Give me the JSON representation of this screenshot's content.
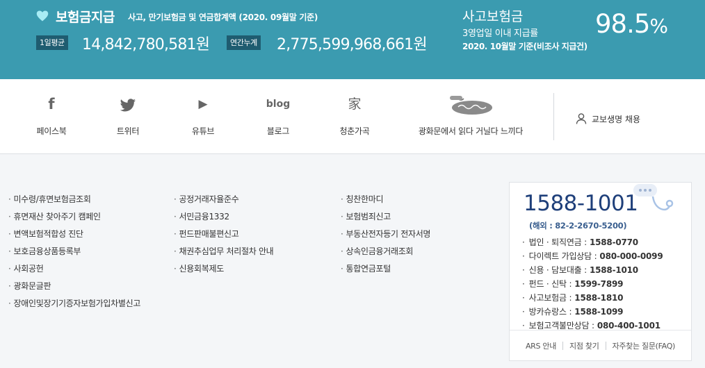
{
  "banner": {
    "title": "보험금지급",
    "subtitle": "사고, 만기보험금 및 연금합계액 (2020. 09월말 기준)",
    "daily_tag": "1일평균",
    "daily_amount": "14,842,780,581원",
    "annual_tag": "연간누계",
    "annual_amount": "2,775,599,968,661원",
    "accident_title": "사고보험금",
    "accident_line1": "3영업일 이내 지급률",
    "accident_line2": "2020. 10월말 기준(비조사 지급건)",
    "accident_rate": "98.5",
    "accident_rate_unit": "%",
    "heart_color": "#a8ecf5",
    "bg_color": "#3b9bb0"
  },
  "social": {
    "items": [
      {
        "icon": "facebook-icon",
        "glyph": "f",
        "label": "페이스북"
      },
      {
        "icon": "twitter-icon",
        "glyph": "",
        "label": "트위터"
      },
      {
        "icon": "youtube-icon",
        "glyph": "▶",
        "label": "유튜브"
      },
      {
        "icon": "blog-icon",
        "glyph": "blog",
        "label": "블로그"
      },
      {
        "icon": "family-icon",
        "glyph": "家",
        "label": "청춘가곡"
      },
      {
        "icon": "gwanghwamun-icon",
        "glyph": "",
        "label": "광화문에서 읽다 거닐다 느끼다"
      }
    ],
    "recruit_label": "교보생명 채용"
  },
  "footer_links": {
    "col1": [
      "미수령/휴면보험금조회",
      "휴면재산 찾아주기 캠페인",
      "변액보험적합성 진단",
      "보호금융상품등록부",
      "사회공헌",
      "광화문글판",
      "장애인및장기기증자보험가입차별신고"
    ],
    "col2": [
      "공정거래자율준수",
      "서민금융1332",
      "펀드판매불편신고",
      "채권추심업무 처리절차 안내",
      "신용회복제도"
    ],
    "col3": [
      "칭찬한마디",
      "보험범죄신고",
      "부동산전자등기 전자서명",
      "상속인금융거래조회",
      "통합연금포털"
    ]
  },
  "contact": {
    "main_phone": "1588-1001",
    "overseas": "(해외 : 82-2-2670-5200)",
    "lines": [
      {
        "label": "법인 · 퇴직연금 :",
        "number": "1588-0770"
      },
      {
        "label": "다이렉트 가입상담 :",
        "number": "080-000-0099"
      },
      {
        "label": "신용 · 담보대출 :",
        "number": "1588-1010"
      },
      {
        "label": "펀드 · 신탁 :",
        "number": "1599-7899"
      },
      {
        "label": "사고보험금 :",
        "number": "1588-1810"
      },
      {
        "label": "방카슈랑스 :",
        "number": "1588-1099"
      },
      {
        "label": "보험고객불만상담 :",
        "number": "080-400-1001"
      }
    ],
    "footer_links": [
      "ARS 안내",
      "지점 찾기",
      "자주찾는 질문(FAQ)"
    ],
    "brand_color": "#1e3f7a"
  }
}
